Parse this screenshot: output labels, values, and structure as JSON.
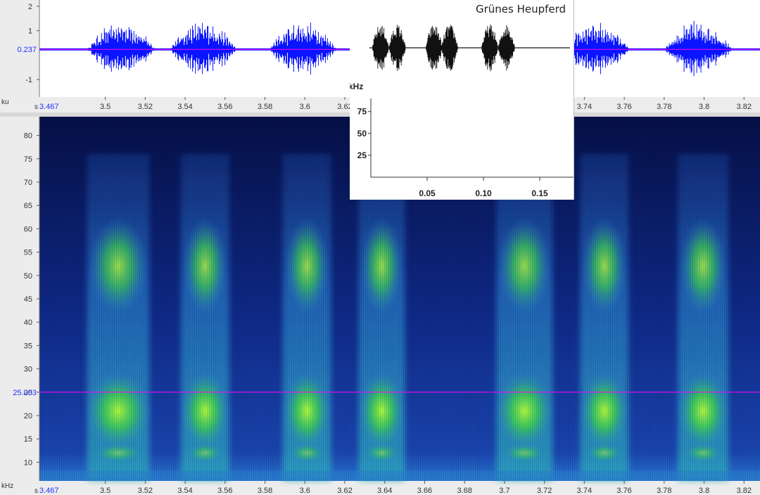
{
  "inset_title": "Grünes Heupferd",
  "colors": {
    "waveform": "#0a14ff",
    "cursor": "#ff00ff",
    "spec_low": "#0a1660",
    "spec_mid": "#1f5fd6",
    "spec_high": "#7cff30",
    "axis_bg": "#ececec",
    "blue_text": "#2030ff"
  },
  "chart_data": [
    {
      "type": "area",
      "name": "waveform",
      "ylabel": "ku",
      "yticks": [
        {
          "value": 2,
          "label": "2"
        },
        {
          "value": 1,
          "label": "1"
        },
        {
          "value": -1,
          "label": "-1"
        }
      ],
      "ylim": [
        -1.6,
        2.2
      ],
      "cursor_y": {
        "value": 0.237,
        "label": "0.237"
      },
      "xlabel": "s",
      "x_start_label": "3.467",
      "xlim": [
        3.467,
        3.828
      ],
      "xticks": [
        "3.5",
        "3.52",
        "3.54",
        "3.56",
        "3.58",
        "3.6",
        "3.62",
        "3.64",
        "3.66",
        "3.68",
        "3.7",
        "3.72",
        "3.74",
        "3.76",
        "3.78",
        "3.8",
        "3.82"
      ],
      "bursts": [
        {
          "center": 3.508,
          "amplitude": 1.5
        },
        {
          "center": 3.549,
          "amplitude": 1.5
        },
        {
          "center": 3.599,
          "amplitude": 1.5
        },
        {
          "center": 3.746,
          "amplitude": 1.4
        },
        {
          "center": 3.797,
          "amplitude": 1.5
        }
      ]
    },
    {
      "type": "heatmap",
      "name": "spectrogram",
      "ylabel": "kHz",
      "yticks": [
        80,
        75,
        70,
        65,
        60,
        55,
        50,
        45,
        40,
        35,
        30,
        25,
        20,
        15,
        10
      ],
      "ylim": [
        6,
        84
      ],
      "cursor_y": {
        "value": 25.003,
        "label": "25.003"
      },
      "xlabel": "s",
      "x_start_label": "3.467",
      "xlim": [
        3.467,
        3.828
      ],
      "xticks": [
        "3.5",
        "3.52",
        "3.54",
        "3.56",
        "3.58",
        "3.6",
        "3.62",
        "3.64",
        "3.66",
        "3.68",
        "3.7",
        "3.72",
        "3.74",
        "3.76",
        "3.78",
        "3.8",
        "3.82"
      ],
      "syllables": [
        {
          "start": 3.493,
          "end": 3.52
        },
        {
          "start": 3.54,
          "end": 3.56
        },
        {
          "start": 3.591,
          "end": 3.611
        },
        {
          "start": 3.629,
          "end": 3.648
        },
        {
          "start": 3.698,
          "end": 3.722
        },
        {
          "start": 3.74,
          "end": 3.76
        },
        {
          "start": 3.789,
          "end": 3.81
        }
      ]
    },
    {
      "type": "heatmap",
      "name": "inset-spectrogram",
      "title": "Grünes Heupferd",
      "ylabel": "kHz",
      "yticks": [
        {
          "value": 75,
          "label": "75"
        },
        {
          "value": 50,
          "label": "50"
        },
        {
          "value": 25,
          "label": "25"
        }
      ],
      "ylim": [
        0,
        90
      ],
      "xticks": [
        {
          "value": 0.05,
          "label": "0.05"
        },
        {
          "value": 0.1,
          "label": "0.10"
        },
        {
          "value": 0.15,
          "label": "0.15"
        }
      ],
      "xlim": [
        0,
        0.18
      ],
      "syllables": [
        {
          "start": 0.008,
          "end": 0.022
        },
        {
          "start": 0.026,
          "end": 0.037
        },
        {
          "start": 0.058,
          "end": 0.07
        },
        {
          "start": 0.073,
          "end": 0.085
        },
        {
          "start": 0.107,
          "end": 0.119
        },
        {
          "start": 0.122,
          "end": 0.135
        }
      ],
      "waveform_bursts": [
        0.01,
        0.025,
        0.058,
        0.072,
        0.108,
        0.123
      ]
    }
  ]
}
